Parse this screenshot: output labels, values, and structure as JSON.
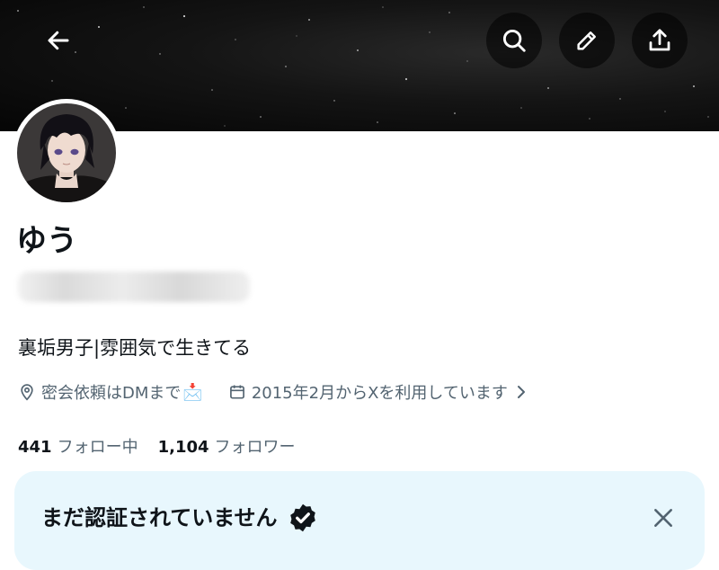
{
  "header": {
    "back_icon": "arrow-left-icon",
    "actions": [
      "search-icon",
      "pencil-icon",
      "share-icon"
    ]
  },
  "profile": {
    "display_name": "ゆう",
    "bio": "裏垢男子|雰囲気で生きてる",
    "location": "密会依頼はDMまで",
    "location_emoji": "📩",
    "joined": "2015年2月からXを利用しています"
  },
  "stats": {
    "following_count": "441",
    "following_label": "フォロー中",
    "followers_count": "1,104",
    "followers_label": "フォロワー"
  },
  "verify_banner": {
    "title": "まだ認証されていません"
  },
  "colors": {
    "text_primary": "#0f1419",
    "text_secondary": "#536471",
    "banner_bg": "#0a0a0a",
    "card_bg": "#e8f7fd"
  }
}
